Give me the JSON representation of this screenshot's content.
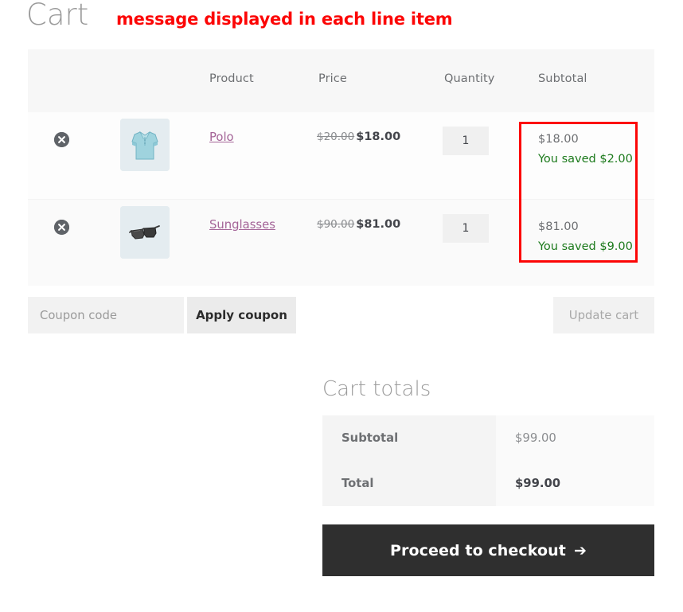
{
  "page": {
    "title": "Cart",
    "annotation": "message displayed in each line item",
    "highlight_color": "#fc0606",
    "saved_color": "#1c7a1c",
    "link_color": "#a46497"
  },
  "cart_table": {
    "headers": {
      "blank_remove": "",
      "blank_thumb": "",
      "product": "Product",
      "price": "Price",
      "quantity": "Quantity",
      "subtotal": "Subtotal"
    },
    "rows": [
      {
        "remove_label": "×",
        "thumb_icon": "polo-shirt-thumbnail",
        "name": "Polo",
        "price_original": "$20.00",
        "price_sale": "$18.00",
        "quantity": "1",
        "subtotal": "$18.00",
        "saved_message": "You saved $2.00"
      },
      {
        "remove_label": "×",
        "thumb_icon": "sunglasses-thumbnail",
        "name": "Sunglasses",
        "price_original": "$90.00",
        "price_sale": "$81.00",
        "quantity": "1",
        "subtotal": "$81.00",
        "saved_message": "You saved $9.00"
      }
    ]
  },
  "actions": {
    "coupon_placeholder": "Coupon code",
    "coupon_value": "",
    "apply_coupon_label": "Apply coupon",
    "update_cart_label": "Update cart"
  },
  "totals": {
    "title": "Cart totals",
    "rows": [
      {
        "label": "Subtotal",
        "value": "$99.00"
      },
      {
        "label": "Total",
        "value": "$99.00"
      }
    ],
    "checkout_label": "Proceed to checkout",
    "checkout_arrow": "➔"
  }
}
